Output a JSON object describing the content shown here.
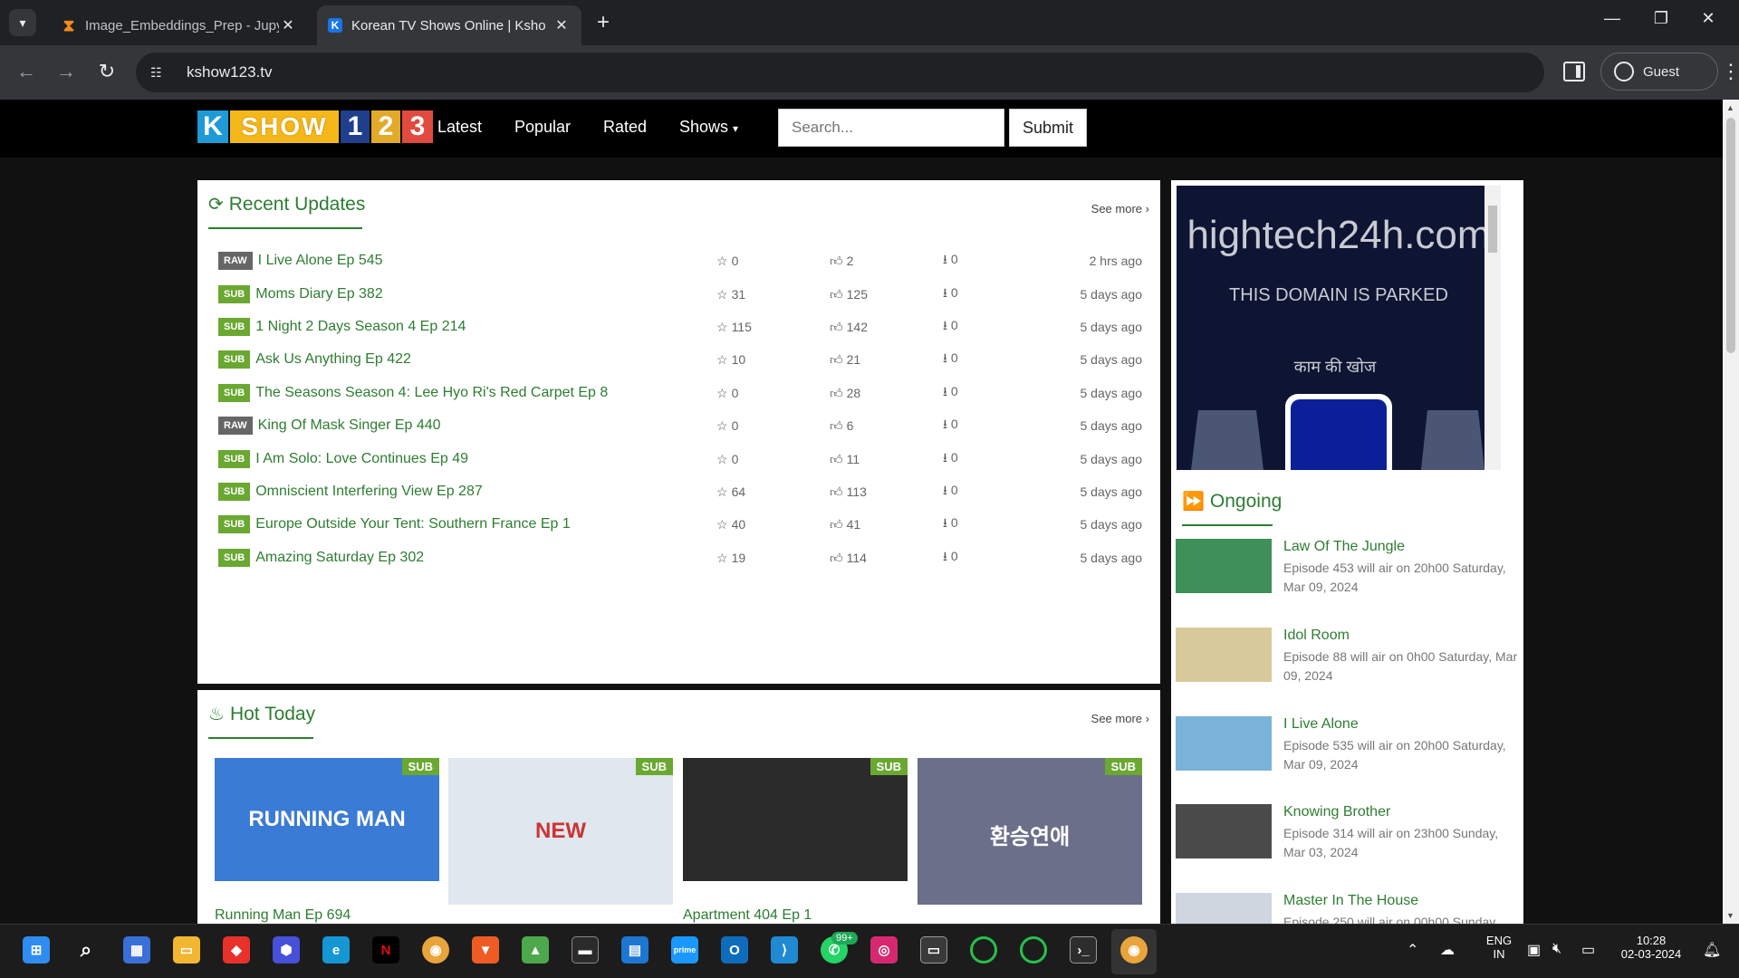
{
  "browser": {
    "tabs": [
      {
        "title": "Image_Embeddings_Prep - Jupy",
        "active": false
      },
      {
        "title": "Korean TV Shows Online | Ksho",
        "active": true
      }
    ],
    "url": "kshow123.tv",
    "profile_label": "Guest"
  },
  "site": {
    "logo": {
      "k": "K",
      "show": "SHOW",
      "n1": "1",
      "n2": "2",
      "n3": "3"
    },
    "nav": [
      "Latest",
      "Popular",
      "Rated",
      "Shows"
    ],
    "search_placeholder": "Search...",
    "submit_label": "Submit"
  },
  "recent": {
    "heading": "Recent Updates",
    "see_more": "See more",
    "rows": [
      {
        "badge": "RAW",
        "title": "I Live Alone Ep 545",
        "stars": "0",
        "likes": "2",
        "downloads": "0",
        "time": "2 hrs ago"
      },
      {
        "badge": "SUB",
        "title": "Moms Diary Ep 382",
        "stars": "31",
        "likes": "125",
        "downloads": "0",
        "time": "5 days ago"
      },
      {
        "badge": "SUB",
        "title": "1 Night 2 Days Season 4 Ep 214",
        "stars": "115",
        "likes": "142",
        "downloads": "0",
        "time": "5 days ago"
      },
      {
        "badge": "SUB",
        "title": "Ask Us Anything Ep 422",
        "stars": "10",
        "likes": "21",
        "downloads": "0",
        "time": "5 days ago"
      },
      {
        "badge": "SUB",
        "title": "The Seasons Season 4: Lee Hyo Ri's Red Carpet Ep 8",
        "stars": "0",
        "likes": "28",
        "downloads": "0",
        "time": "5 days ago"
      },
      {
        "badge": "RAW",
        "title": "King Of Mask Singer Ep 440",
        "stars": "0",
        "likes": "6",
        "downloads": "0",
        "time": "5 days ago"
      },
      {
        "badge": "SUB",
        "title": "I Am Solo: Love Continues Ep 49",
        "stars": "0",
        "likes": "11",
        "downloads": "0",
        "time": "5 days ago"
      },
      {
        "badge": "SUB",
        "title": "Omniscient Interfering View Ep 287",
        "stars": "64",
        "likes": "113",
        "downloads": "0",
        "time": "5 days ago"
      },
      {
        "badge": "SUB",
        "title": "Europe Outside Your Tent: Southern France Ep 1",
        "stars": "40",
        "likes": "41",
        "downloads": "0",
        "time": "5 days ago"
      },
      {
        "badge": "SUB",
        "title": "Amazing Saturday Ep 302",
        "stars": "19",
        "likes": "114",
        "downloads": "0",
        "time": "5 days ago"
      }
    ]
  },
  "hot": {
    "heading": "Hot Today",
    "see_more": "See more",
    "cards": [
      {
        "badge": "SUB",
        "caption": "Running Man Ep 694",
        "poster_text": "RUNNING MAN",
        "color": "#3a7bd5"
      },
      {
        "badge": "SUB",
        "caption": "",
        "poster_text": "NEW",
        "color": "#dfe7ef"
      },
      {
        "badge": "SUB",
        "caption": "Apartment 404 Ep 1",
        "poster_text": "",
        "color": "#2b2b2b"
      },
      {
        "badge": "SUB",
        "caption": "",
        "poster_text": "환승연애",
        "color": "#6b6f8a"
      }
    ]
  },
  "ad": {
    "domain": "hightech24h.com",
    "parked": "THIS DOMAIN IS PARKED",
    "hindi": "काम की खोज"
  },
  "ongoing": {
    "heading": "Ongoing",
    "items": [
      {
        "name": "Law Of The Jungle",
        "desc": "Episode 453 will air on 20h00 Saturday, Mar 09, 2024",
        "color": "#3f8f5a"
      },
      {
        "name": "Idol Room",
        "desc": "Episode 88 will air on 0h00 Saturday, Mar 09, 2024",
        "color": "#d8c99a"
      },
      {
        "name": "I Live Alone",
        "desc": "Episode 535 will air on 20h00 Saturday, Mar 09, 2024",
        "color": "#7ab3d9"
      },
      {
        "name": "Knowing Brother",
        "desc": "Episode 314 will air on 23h00 Sunday, Mar 03, 2024",
        "color": "#4b4b4b"
      },
      {
        "name": "Master In The House",
        "desc": "Episode 250 will air on 00h00 Sunday",
        "color": "#cfd6e0"
      }
    ]
  },
  "taskbar": {
    "lang": "ENG",
    "region": "IN",
    "time": "10:28",
    "date": "02-03-2024",
    "whatsapp_badge": "99+"
  }
}
